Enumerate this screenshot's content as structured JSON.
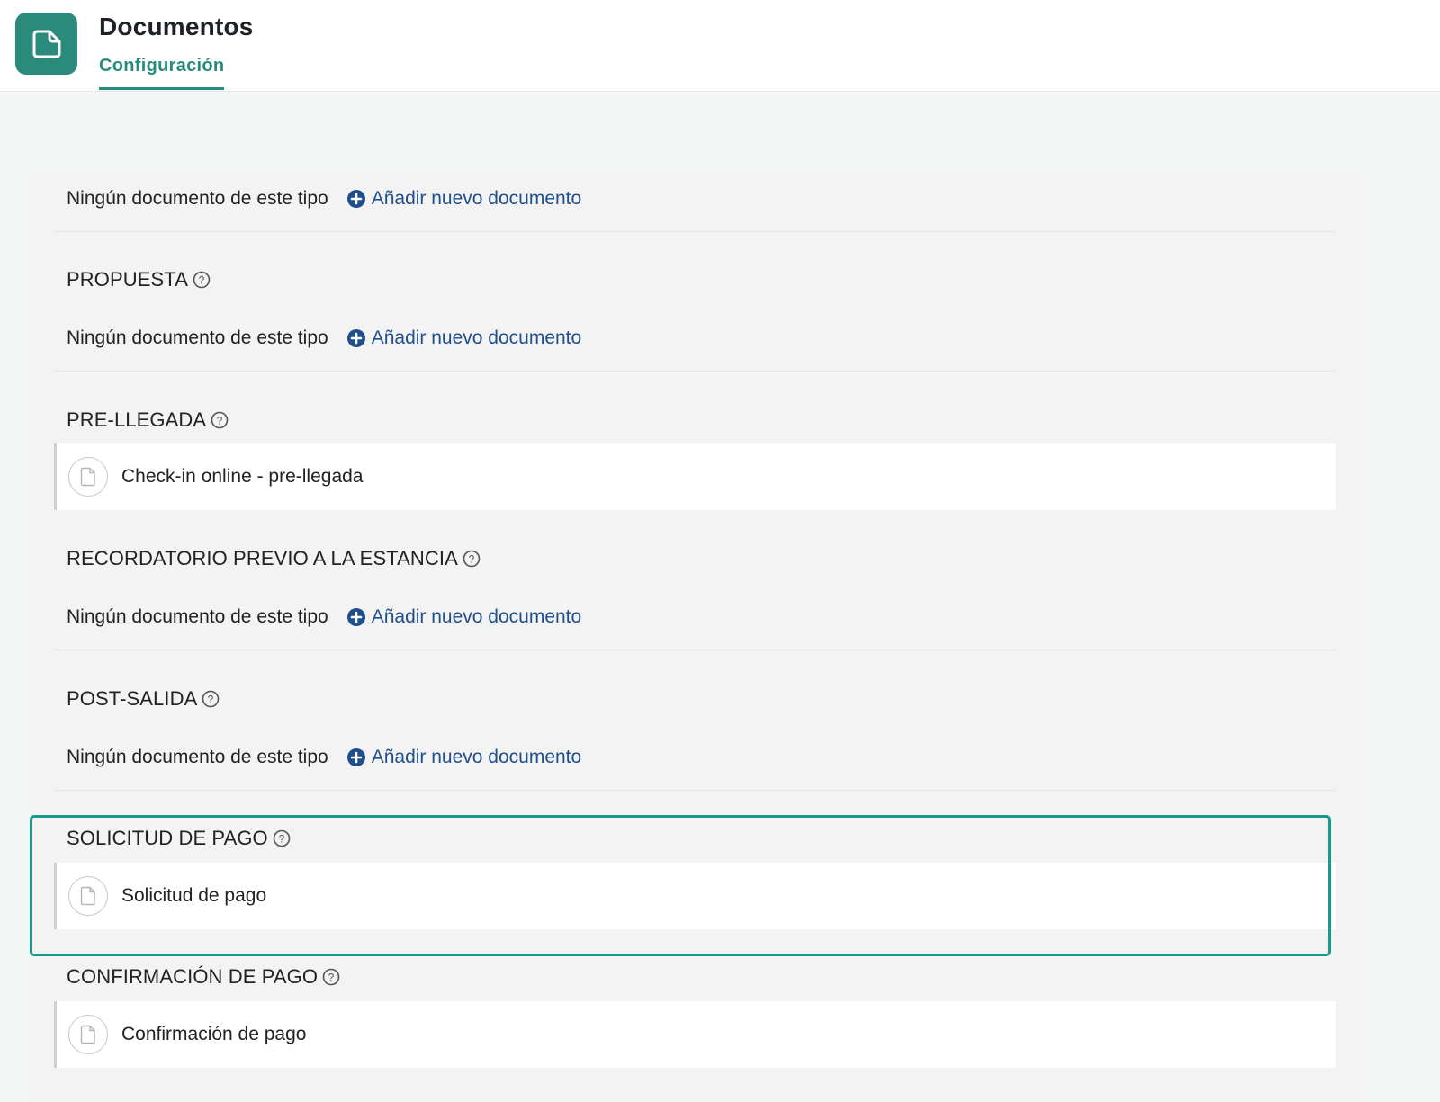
{
  "header": {
    "app_title": "Documentos",
    "active_tab": "Configuración",
    "brand_color": "#2a8a7b",
    "app_icon": "document-corner-icon"
  },
  "strings": {
    "empty_text": "Ningún documento de este tipo",
    "add_label": "Añadir nuevo documento"
  },
  "sections": [
    {
      "title": "",
      "documents": []
    },
    {
      "title": "PROPUESTA",
      "documents": []
    },
    {
      "title": "PRE-LLEGADA",
      "documents": [
        {
          "label": "Check-in online - pre-llegada"
        }
      ]
    },
    {
      "title": "RECORDATORIO PREVIO A LA ESTANCIA",
      "documents": []
    },
    {
      "title": "POST-SALIDA",
      "documents": []
    },
    {
      "title": "SOLICITUD DE PAGO",
      "documents": [
        {
          "label": "Solicitud de pago"
        }
      ],
      "highlighted": true
    },
    {
      "title": "CONFIRMACIÓN DE PAGO",
      "documents": [
        {
          "label": "Confirmación de pago"
        }
      ]
    }
  ],
  "colors": {
    "highlight_border": "#1a9b8a",
    "link": "#1f4e8c"
  }
}
